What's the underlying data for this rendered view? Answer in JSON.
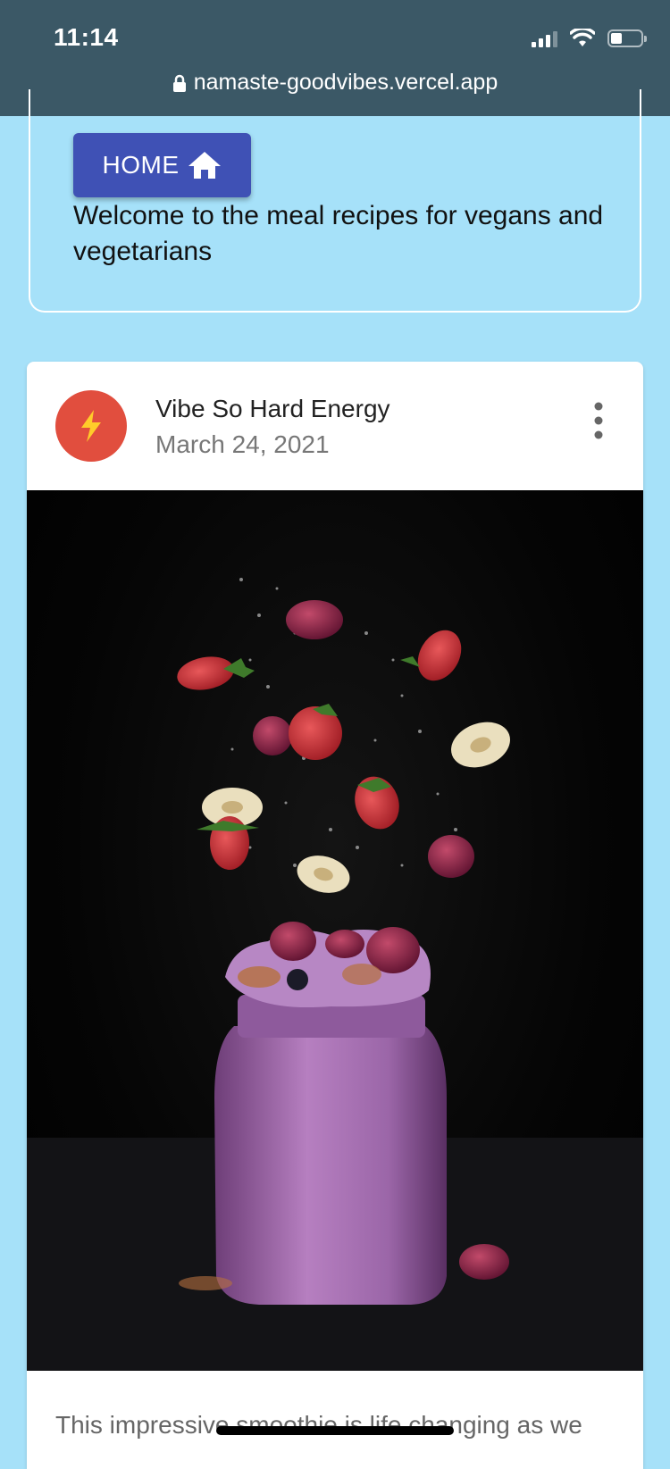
{
  "status_bar": {
    "time": "11:14",
    "icons": [
      "signal-icon",
      "wifi-icon",
      "battery-icon"
    ]
  },
  "browser": {
    "url": "namaste-goodvibes.vercel.app",
    "icon": "lock-icon"
  },
  "welcome": {
    "home_label": "HOME",
    "home_icon": "home-icon",
    "text": "Welcome to the meal recipes for vegans and vegetarians"
  },
  "card": {
    "avatar_icon": "lightning-icon",
    "avatar_color": "#e14e3e",
    "title": "Vibe So Hard Energy",
    "date": "March 24, 2021",
    "menu_icon": "more-vert-icon",
    "image_subject": "purple berry smoothie jar with floating strawberries, blackberries and banana slices",
    "body_text": "This impressive smoothie is life changing as we"
  },
  "colors": {
    "background": "#a6e1f9",
    "topbar": "#3b5866",
    "home_button": "#3f51b5",
    "avatar": "#e14e3e"
  }
}
